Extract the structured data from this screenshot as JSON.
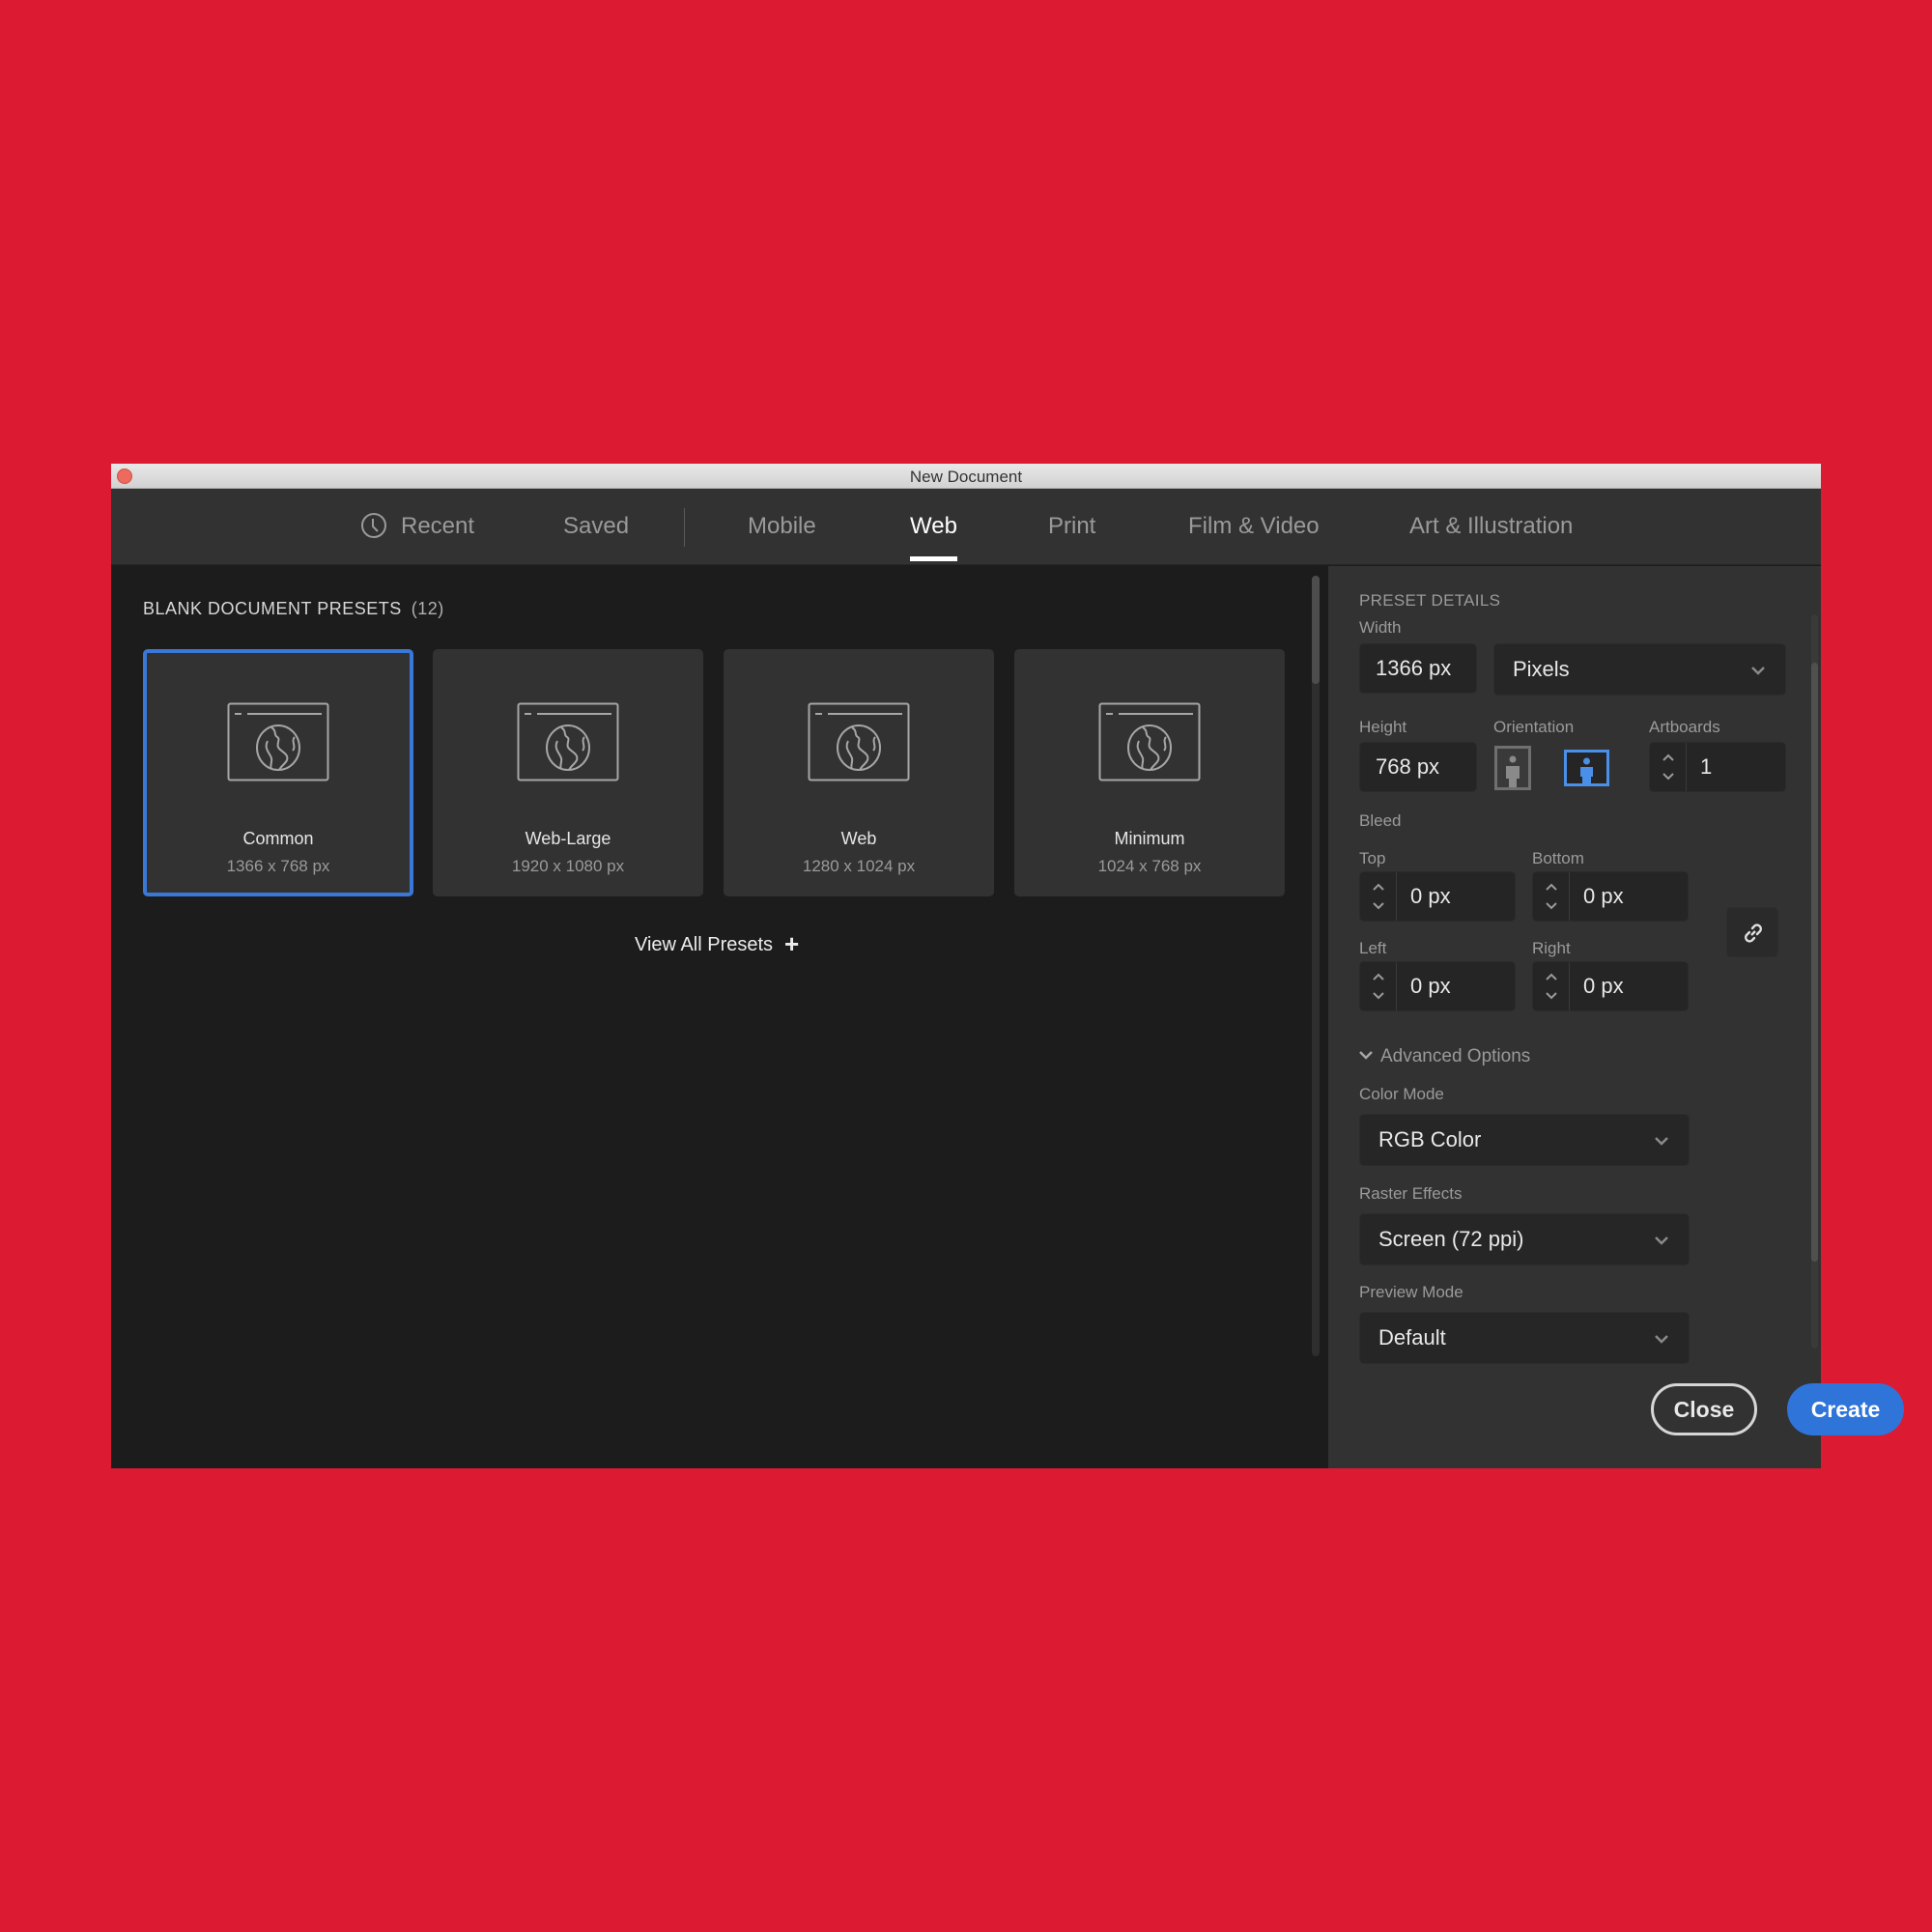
{
  "window": {
    "title": "New Document"
  },
  "tabs": [
    {
      "label": "Recent",
      "icon": "clock-icon"
    },
    {
      "label": "Saved"
    },
    {
      "label": "Mobile"
    },
    {
      "label": "Web",
      "active": true
    },
    {
      "label": "Print"
    },
    {
      "label": "Film & Video"
    },
    {
      "label": "Art & Illustration"
    }
  ],
  "presets": {
    "title": "BLANK DOCUMENT PRESETS",
    "count": "(12)",
    "items": [
      {
        "name": "Common",
        "size": "1366 x 768 px",
        "selected": true,
        "icon": "web-globe-icon"
      },
      {
        "name": "Web-Large",
        "size": "1920 x 1080 px",
        "icon": "web-globe-icon"
      },
      {
        "name": "Web",
        "size": "1280 x 1024 px",
        "icon": "web-globe-icon"
      },
      {
        "name": "Minimum",
        "size": "1024 x 768 px",
        "icon": "web-globe-icon"
      }
    ],
    "view_all_label": "View All Presets"
  },
  "details": {
    "header": "PRESET DETAILS",
    "width_label": "Width",
    "width_value": "1366 px",
    "units_value": "Pixels",
    "height_label": "Height",
    "height_value": "768 px",
    "orientation_label": "Orientation",
    "orientation_selected": "landscape",
    "artboards_label": "Artboards",
    "artboards_value": "1",
    "bleed_label": "Bleed",
    "bleed": {
      "top_label": "Top",
      "top_value": "0 px",
      "bottom_label": "Bottom",
      "bottom_value": "0 px",
      "left_label": "Left",
      "left_value": "0 px",
      "right_label": "Right",
      "right_value": "0 px"
    },
    "advanced_label": "Advanced Options",
    "color_mode_label": "Color Mode",
    "color_mode_value": "RGB Color",
    "raster_label": "Raster Effects",
    "raster_value": "Screen (72 ppi)",
    "preview_label": "Preview Mode",
    "preview_value": "Default"
  },
  "buttons": {
    "close": "Close",
    "create": "Create"
  },
  "colors": {
    "accent": "#2f74d8",
    "selection_border": "#3a78d8",
    "background": "#dc1a31"
  }
}
